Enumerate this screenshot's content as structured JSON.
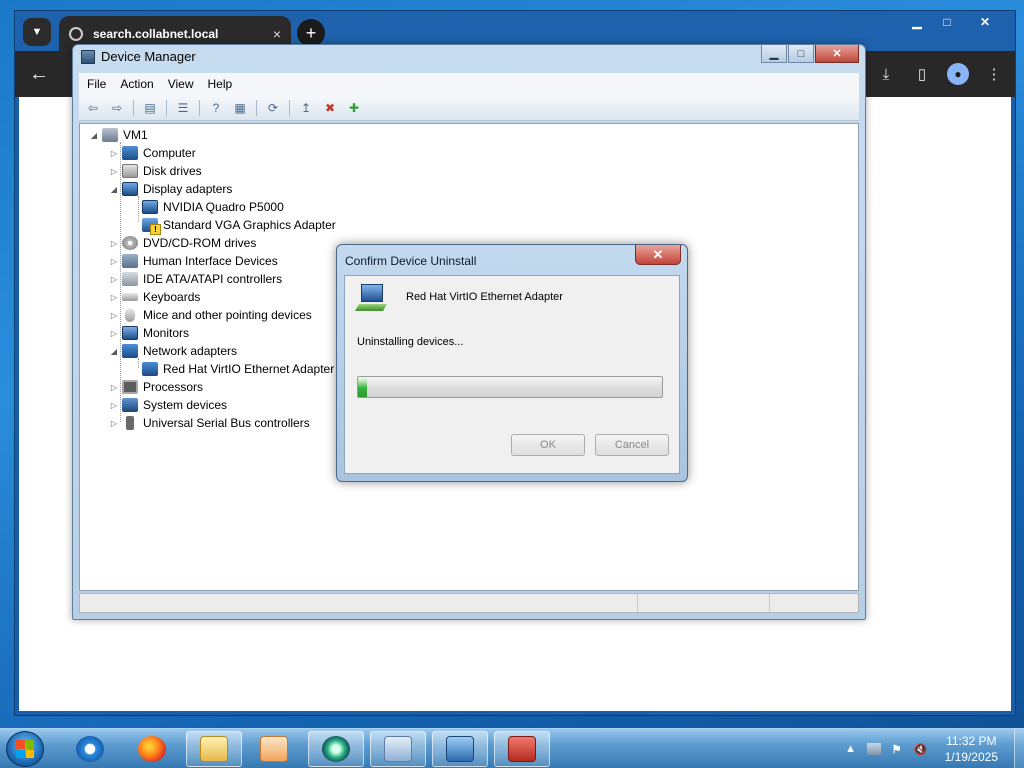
{
  "browser": {
    "tab_title": "search.collabnet.local",
    "tab_menu_icon": "chevron-down-icon",
    "close_tab_glyph": "×",
    "new_tab_glyph": "+",
    "back_glyph": "←",
    "win_controls": {
      "minimize": "▁",
      "maximize": "□",
      "close": "✕"
    },
    "toolbar_icons": {
      "download": "⤓",
      "sidebar": "▯",
      "profile": "●",
      "menu": "⋮"
    }
  },
  "device_manager": {
    "title": "Device Manager",
    "window_controls": {
      "minimize": "▁",
      "maximize": "□",
      "close": "✕"
    },
    "menu": [
      "File",
      "Action",
      "View",
      "Help"
    ],
    "toolbar_glyphs": {
      "back": "⇦",
      "forward": "⇨",
      "show_hide": "▤",
      "properties": "☰",
      "help": "?",
      "action_pane": "▦",
      "scan": "⟳",
      "update": "↥",
      "uninstall": "✖",
      "add": "✚"
    },
    "tree": {
      "root": "VM1",
      "items": [
        "Computer",
        "Disk drives",
        "Display adapters",
        "NVIDIA Quadro P5000",
        "Standard VGA Graphics Adapter",
        "DVD/CD-ROM drives",
        "Human Interface Devices",
        "IDE ATA/ATAPI controllers",
        "Keyboards",
        "Mice and other pointing devices",
        "Monitors",
        "Network adapters",
        "Red Hat VirtIO Ethernet Adapter",
        "Processors",
        "System devices",
        "Universal Serial Bus controllers"
      ]
    }
  },
  "dialog": {
    "title": "Confirm Device Uninstall",
    "close_glyph": "✕",
    "device_name": "Red Hat VirtIO Ethernet Adapter",
    "status_text": "Uninstalling devices...",
    "progress_fraction": 0.03,
    "ok_label": "OK",
    "cancel_label": "Cancel"
  },
  "taskbar": {
    "apps": [
      "internet-explorer",
      "firefox",
      "file-explorer",
      "media-player",
      "remote-app",
      "control-panel",
      "device-manager",
      "toolbox"
    ],
    "tray_time": "11:32 PM",
    "tray_date": "1/19/2025",
    "tray_glyphs": {
      "show_hidden": "▲",
      "volume": "🔇"
    }
  },
  "colors": {
    "desktop": "#1b78c9",
    "progress_fill": "#35b33c",
    "dialog_close": "#c2443a"
  }
}
